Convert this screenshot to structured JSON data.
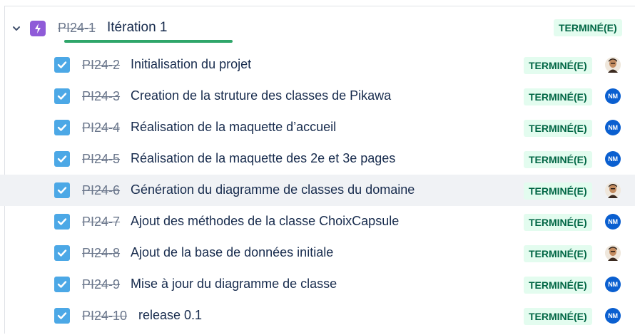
{
  "epic": {
    "key": "PI24-1",
    "title": "Itération 1",
    "status": "TERMINÉ(E)",
    "icon": "lightning-icon",
    "color": "#8f5bd8",
    "progress_done_fraction": 1.0
  },
  "status_color": {
    "bg": "#e3fcef",
    "text": "#006644"
  },
  "issues": [
    {
      "key": "PI24-2",
      "title": "Initialisation du projet",
      "status": "TERMINÉ(E)",
      "assignee": "photo"
    },
    {
      "key": "PI24-3",
      "title": "Creation de la struture des classes de Pikawa",
      "status": "TERMINÉ(E)",
      "assignee": "NM"
    },
    {
      "key": "PI24-4",
      "title": "Réalisation de la maquette d’accueil",
      "status": "TERMINÉ(E)",
      "assignee": "NM"
    },
    {
      "key": "PI24-5",
      "title": "Réalisation de la maquette des 2e et 3e pages",
      "status": "TERMINÉ(E)",
      "assignee": "NM"
    },
    {
      "key": "PI24-6",
      "title": "Génération du diagramme de classes du domaine",
      "status": "TERMINÉ(E)",
      "assignee": "photo"
    },
    {
      "key": "PI24-7",
      "title": "Ajout des méthodes de la classe ChoixCapsule",
      "status": "TERMINÉ(E)",
      "assignee": "NM"
    },
    {
      "key": "PI24-8",
      "title": "Ajout de la base de données initiale",
      "status": "TERMINÉ(E)",
      "assignee": "photo"
    },
    {
      "key": "PI24-9",
      "title": "Mise à jour du diagramme de classe",
      "status": "TERMINÉ(E)",
      "assignee": "NM"
    },
    {
      "key": "PI24-10",
      "title": "release 0.1",
      "status": "TERMINÉ(E)",
      "assignee": "NM"
    }
  ]
}
